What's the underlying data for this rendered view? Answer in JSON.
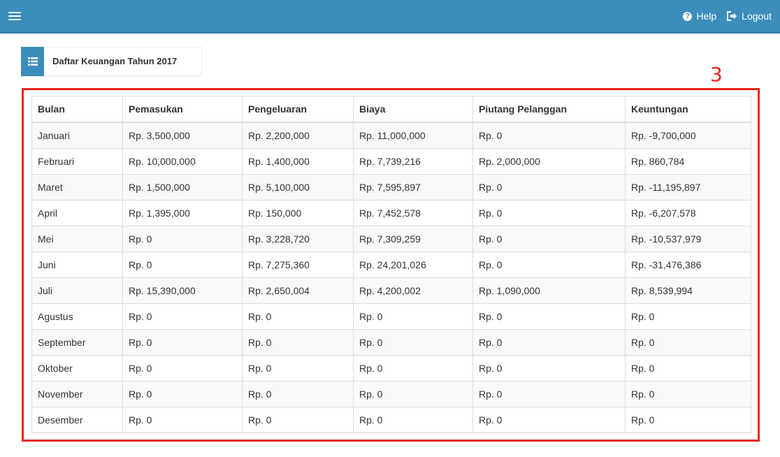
{
  "navbar": {
    "help_label": "Help",
    "logout_label": "Logout",
    "accent_color": "#3c8dbc"
  },
  "panel": {
    "title": "Daftar Keuangan Tahun 2017",
    "icon": "list-icon"
  },
  "annotation": {
    "number": "3",
    "color": "#e8241c"
  },
  "table": {
    "headers": [
      "Bulan",
      "Pemasukan",
      "Pengeluaran",
      "Biaya",
      "Piutang Pelanggan",
      "Keuntungan"
    ],
    "rows": [
      [
        "Januari",
        "Rp. 3,500,000",
        "Rp. 2,200,000",
        "Rp. 11,000,000",
        "Rp. 0",
        "Rp. -9,700,000"
      ],
      [
        "Februari",
        "Rp. 10,000,000",
        "Rp. 1,400,000",
        "Rp. 7,739,216",
        "Rp. 2,000,000",
        "Rp. 860,784"
      ],
      [
        "Maret",
        "Rp. 1,500,000",
        "Rp. 5,100,000",
        "Rp. 7,595,897",
        "Rp. 0",
        "Rp. -11,195,897"
      ],
      [
        "April",
        "Rp. 1,395,000",
        "Rp. 150,000",
        "Rp. 7,452,578",
        "Rp. 0",
        "Rp. -6,207,578"
      ],
      [
        "Mei",
        "Rp. 0",
        "Rp. 3,228,720",
        "Rp. 7,309,259",
        "Rp. 0",
        "Rp. -10,537,979"
      ],
      [
        "Juni",
        "Rp. 0",
        "Rp. 7,275,360",
        "Rp. 24,201,026",
        "Rp. 0",
        "Rp. -31,476,386"
      ],
      [
        "Juli",
        "Rp. 15,390,000",
        "Rp. 2,650,004",
        "Rp. 4,200,002",
        "Rp. 1,090,000",
        "Rp. 8,539,994"
      ],
      [
        "Agustus",
        "Rp. 0",
        "Rp. 0",
        "Rp. 0",
        "Rp. 0",
        "Rp. 0"
      ],
      [
        "September",
        "Rp. 0",
        "Rp. 0",
        "Rp. 0",
        "Rp. 0",
        "Rp. 0"
      ],
      [
        "Oktober",
        "Rp. 0",
        "Rp. 0",
        "Rp. 0",
        "Rp. 0",
        "Rp. 0"
      ],
      [
        "November",
        "Rp. 0",
        "Rp. 0",
        "Rp. 0",
        "Rp. 0",
        "Rp. 0"
      ],
      [
        "Desember",
        "Rp. 0",
        "Rp. 0",
        "Rp. 0",
        "Rp. 0",
        "Rp. 0"
      ]
    ]
  }
}
